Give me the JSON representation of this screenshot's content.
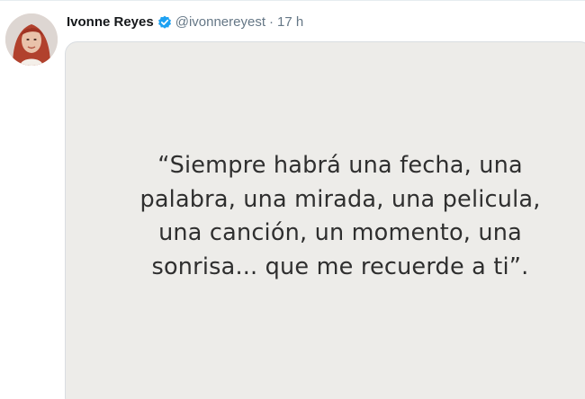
{
  "tweet": {
    "author_name": "Ivonne Reyes",
    "handle": "@ivonnereyest",
    "separator": "·",
    "time": "17 h"
  },
  "quote": {
    "lines": [
      "“Siempre habrá una fecha, una",
      "palabra, una mirada, una pelicula,",
      "una canción, un momento, una",
      "sonrisa... que me recuerde a ti”."
    ]
  },
  "icons": {
    "verified": "verified-badge-icon",
    "avatar": "profile-photo"
  },
  "colors": {
    "verified_blue": "#1da1f2",
    "muted_text": "#657786",
    "name_text": "#14171a",
    "image_background": "#edece9"
  }
}
